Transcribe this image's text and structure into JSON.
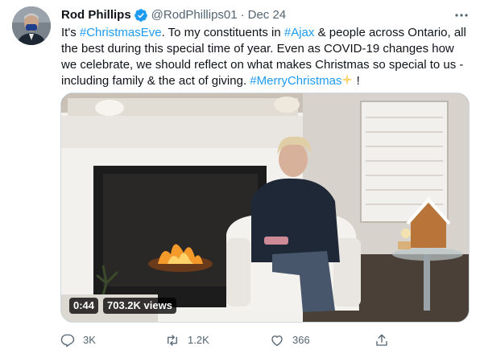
{
  "tweet": {
    "author": {
      "display_name": "Rod Phillips",
      "handle": "@RodPhillips01",
      "verified": true
    },
    "separator": "·",
    "date": "Dec 24",
    "text_segments": [
      {
        "text": "It's ",
        "type": "text"
      },
      {
        "text": "#ChristmasEve",
        "type": "hashtag"
      },
      {
        "text": ". To my constituents in ",
        "type": "text"
      },
      {
        "text": "#Ajax",
        "type": "hashtag"
      },
      {
        "text": " & people across Ontario, all the best during this special time of year. Even as COVID-19 changes how we celebrate, we should reflect on what makes Christmas so special to us - including family & the act of giving. ",
        "type": "text"
      },
      {
        "text": "#MerryChristmas",
        "type": "hashtag"
      }
    ],
    "text_suffix": " !",
    "emoji_icon": "sparkle-icon",
    "video": {
      "duration": "0:44",
      "views": "703.2K views"
    },
    "actions": {
      "replies": "3K",
      "retweets": "1.2K",
      "likes": "366"
    }
  },
  "colors": {
    "link": "#1d9bf0",
    "text": "#0f1419",
    "secondary": "#536471",
    "verified": "#1d9bf0"
  }
}
